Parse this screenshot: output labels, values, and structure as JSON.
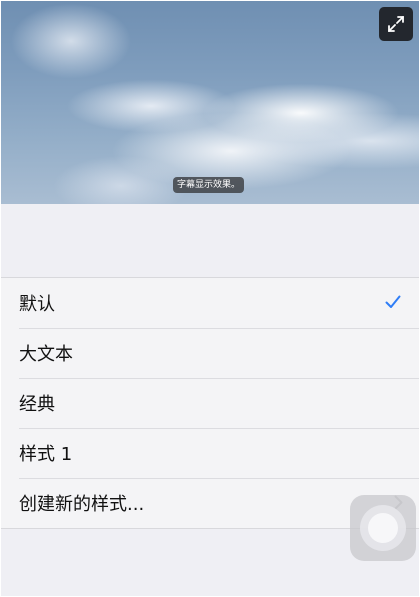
{
  "preview": {
    "caption": "字幕显示效果。",
    "expand_icon": "expand-arrows-icon"
  },
  "list": {
    "items": [
      {
        "label": "默认",
        "selected": true
      },
      {
        "label": "大文本",
        "selected": false
      },
      {
        "label": "经典",
        "selected": false
      },
      {
        "label": "样式 1",
        "selected": false
      },
      {
        "label": "创建新的样式...",
        "selected": false,
        "disclosure": true
      }
    ]
  },
  "colors": {
    "accent": "#2f7df6",
    "background": "#efeff4",
    "row_background": "#f4f4f6",
    "expand_button": "#23272e"
  },
  "icons": {
    "selected": "checkmark-icon",
    "disclosure": "chevron-right-icon",
    "assistive": "assistive-touch-icon"
  }
}
